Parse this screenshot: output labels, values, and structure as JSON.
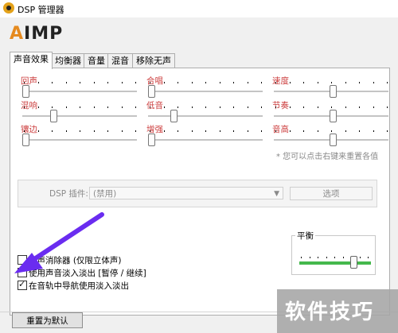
{
  "window": {
    "title": "DSP 管理器"
  },
  "logo": {
    "text_accent": "A",
    "text_rest": "IMP"
  },
  "tabs": [
    {
      "label": "声音效果",
      "active": true
    },
    {
      "label": "均衡器",
      "active": false
    },
    {
      "label": "音量",
      "active": false
    },
    {
      "label": "混音",
      "active": false
    },
    {
      "label": "移除无声",
      "active": false
    }
  ],
  "sliders": [
    {
      "label": "回声",
      "value": 0.0
    },
    {
      "label": "合唱",
      "value": 0.0
    },
    {
      "label": "速度",
      "value": 0.5
    },
    {
      "label": "混响",
      "value": 0.25
    },
    {
      "label": "低音",
      "value": 0.2
    },
    {
      "label": "节奏",
      "value": 0.5
    },
    {
      "label": "镶边",
      "value": 0.0
    },
    {
      "label": "增强",
      "value": 0.0
    },
    {
      "label": "音高",
      "value": 0.5
    }
  ],
  "hint": "* 您可以点击右键来重置各值",
  "dsp": {
    "label": "DSP 插件:",
    "selected": "(禁用)",
    "options_button": "选项"
  },
  "checkboxes": [
    {
      "label": "人声消除器 (仅限立体声)",
      "checked": false
    },
    {
      "label": "使用声音淡入淡出 [暂停 / 继续]",
      "checked": false
    },
    {
      "label": "在音轨中导航使用淡入淡出",
      "checked": true
    }
  ],
  "balance": {
    "label": "平衡",
    "value": 0.75
  },
  "footer": {
    "reset_button": "重置为默认"
  },
  "watermark": "软件技巧",
  "colors": {
    "accent_orange": "#e58a1f",
    "label_red": "#cc3e3e",
    "balance_green": "#44b84c",
    "arrow_purple": "#6a2cf0"
  }
}
